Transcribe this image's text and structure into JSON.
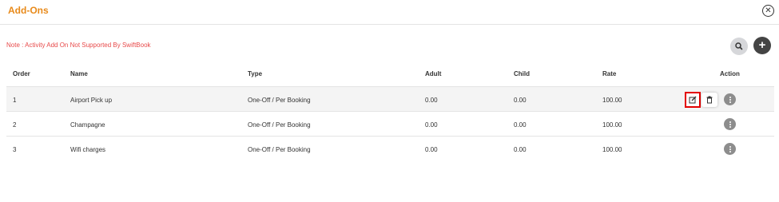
{
  "modal": {
    "title": "Add-Ons",
    "close_icon": "close-circle-icon",
    "note": "Note : Activity Add On Not Supported By SwiftBook",
    "search_icon": "search-icon",
    "add_label": "+"
  },
  "colors": {
    "title": "#e88a1a",
    "note": "#e84a4a",
    "highlight_border": "#e30000"
  },
  "table": {
    "headers": [
      "Order",
      "Name",
      "Type",
      "Adult",
      "Child",
      "Rate",
      "Action"
    ],
    "rows": [
      {
        "order": "1",
        "name": "Airport Pick up",
        "type": "One-Off / Per Booking",
        "adult": "0.00",
        "child": "0.00",
        "rate": "100.00"
      },
      {
        "order": "2",
        "name": "Champagne",
        "type": "One-Off / Per Booking",
        "adult": "0.00",
        "child": "0.00",
        "rate": "100.00"
      },
      {
        "order": "3",
        "name": "Wifi charges",
        "type": "One-Off / Per Booking",
        "adult": "0.00",
        "child": "0.00",
        "rate": "100.00"
      }
    ]
  }
}
